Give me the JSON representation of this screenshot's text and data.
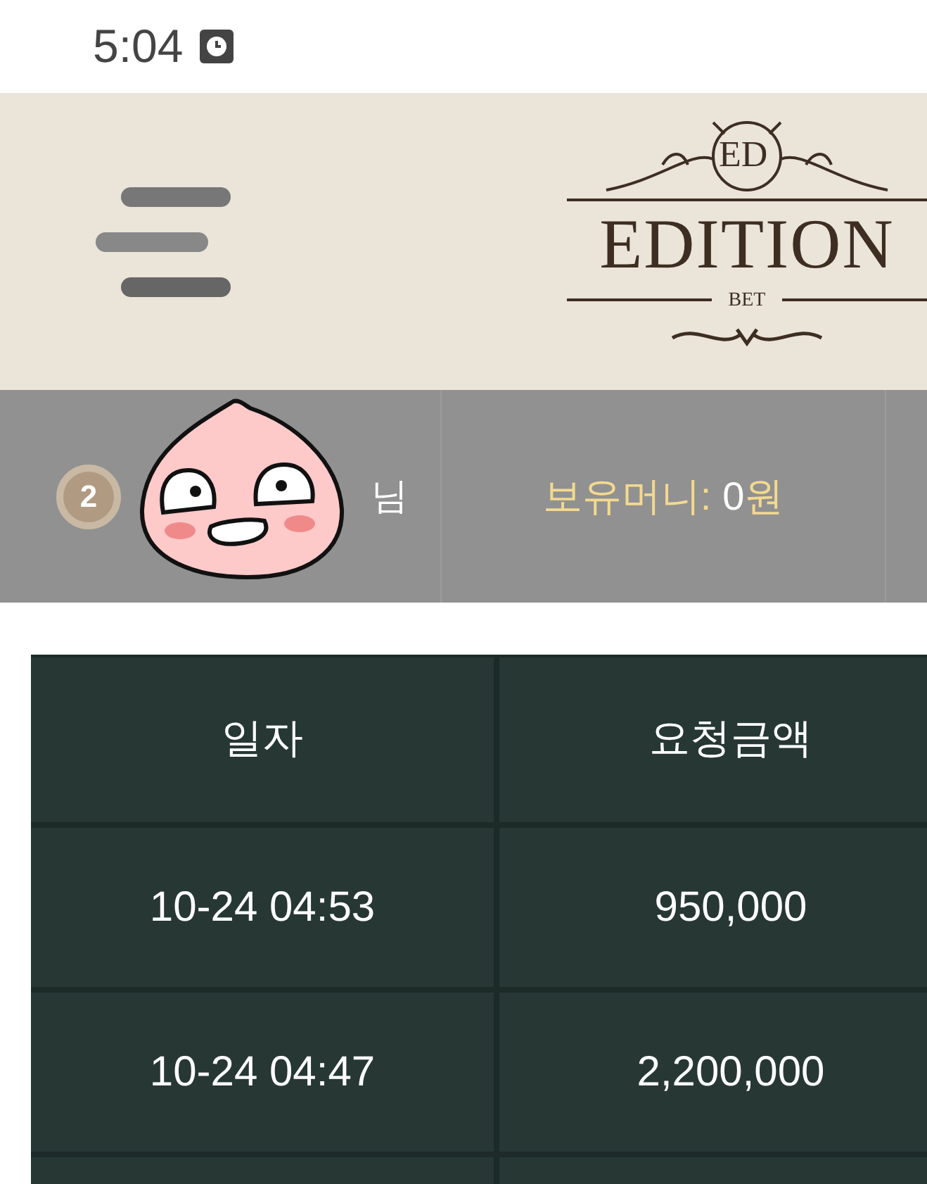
{
  "status_bar": {
    "time": "5:04"
  },
  "header": {
    "logo": {
      "monogram": "ED",
      "name": "EDITION",
      "sub": "BET"
    }
  },
  "user_bar": {
    "level": "2",
    "suffix": "님",
    "money_label": "보유머니:",
    "money_value": "0",
    "money_unit": "원"
  },
  "table": {
    "columns": [
      "일자",
      "요청금액"
    ],
    "rows": [
      [
        "10-24 04:53",
        "950,000"
      ],
      [
        "10-24 04:47",
        "2,200,000"
      ]
    ]
  }
}
